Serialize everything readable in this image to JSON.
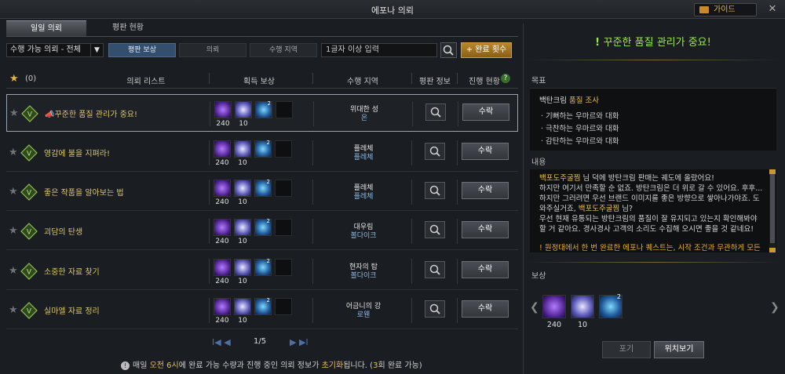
{
  "window": {
    "title": "에포나 의뢰",
    "guide_label": "가이드",
    "close_label": "✕"
  },
  "tabs": [
    {
      "label": "일일 의뢰",
      "active": true
    },
    {
      "label": "평판 현황",
      "active": false
    }
  ],
  "filter": {
    "value": "수행 가능 의뢰 - 전체"
  },
  "segments": [
    {
      "label": "평판 보상",
      "active": true
    },
    {
      "label": "의뢰",
      "active": false
    },
    {
      "label": "수행 지역",
      "active": false
    }
  ],
  "search": {
    "placeholder": "1글자 이상 입력"
  },
  "complete_button": "+ 완료 횟수",
  "header": {
    "fav_count": "(0)",
    "list": "의뢰 리스트",
    "reward": "획득 보상",
    "region": "수행 지역",
    "rep": "평판 정보",
    "progress": "진행 현황"
  },
  "rows": [
    {
      "name": "꾸준한 품질 관리가 중요!",
      "prefix": "📣",
      "rewards": [
        "240",
        "10"
      ],
      "region1": "위대한 성",
      "region2": "온",
      "accept": "수락"
    },
    {
      "name": "영감에 불을 지펴라!",
      "prefix": "",
      "rewards": [
        "240",
        "10"
      ],
      "region1": "플레체",
      "region2": "플레체",
      "accept": "수락"
    },
    {
      "name": "좋은 작품을 알아보는 법",
      "prefix": "",
      "rewards": [
        "240",
        "10"
      ],
      "region1": "플레체",
      "region2": "플레체",
      "accept": "수락"
    },
    {
      "name": "괴담의 탄생",
      "prefix": "",
      "rewards": [
        "240",
        "10"
      ],
      "region1": "대우림",
      "region2": "볼다이크",
      "accept": "수락"
    },
    {
      "name": "소중한 자료 찾기",
      "prefix": "",
      "rewards": [
        "240",
        "10"
      ],
      "region1": "현자의 탑",
      "region2": "볼다이크",
      "accept": "수락"
    },
    {
      "name": "실마엘 자료 정리",
      "prefix": "",
      "rewards": [
        "240",
        "10"
      ],
      "region1": "어금니의 강",
      "region2": "로웬",
      "accept": "수락"
    }
  ],
  "pager": {
    "text": "1/5"
  },
  "notice": {
    "pre": "매일 ",
    "time": "오전 6시",
    "mid": "에 완료 가능 수량과 진행 중인 의뢰 정보가 ",
    "reset": "초기화",
    "post1": "됩니다. (",
    "count": "3",
    "post2": "회 완료 가능)"
  },
  "detail": {
    "title": "꾸준한 품질 관리가 중요!",
    "goal_label": "목표",
    "goal_main_a": "백탄크림 ",
    "goal_main_b": "품질 조사",
    "goal_items": [
      "· 기뻐하는 우마르와 대화",
      "· 극찬하는 우마르와 대화",
      "· 감탄하는 우마르와 대화"
    ],
    "content_label": "내용",
    "content_lines": [
      {
        "gold": "백포도주굴찜",
        "text": " 님 덕에 방탄크림 판매는 궤도에 올랐어요!"
      },
      {
        "gold": "",
        "text": "하지만 여기서 만족할 순 없죠. 방탄크림은 더 위로 갈 수 있어요. 후후..."
      },
      {
        "gold": "",
        "text": "하지만 그러려면 우선 브랜드 이미지를 좋은 방향으로 쌓아나가야죠. 도"
      },
      {
        "gold": "",
        "text": "와주실거죠, "
      },
      {
        "gold": "",
        "text": "우선 현재 유통되는 방탄크림의 품질이 잘 유지되고 있는지 확인해봐야"
      },
      {
        "gold": "",
        "text": "할 거 같아요. 경사경사 고객의 소리도 수집해 오시면 좋을 것 같네요!"
      }
    ],
    "content_l4_gold": "백포도주굴찜",
    "content_l4_tail": " 님?",
    "warn_text": "! 원정대에서 한 번 완료한 에포나 퀘스트는, 시작 조건과 무관하게 모든",
    "reward_label": "보상",
    "reward_values": [
      "240",
      "10"
    ],
    "giveup": "포기",
    "locate": "위치보기"
  }
}
